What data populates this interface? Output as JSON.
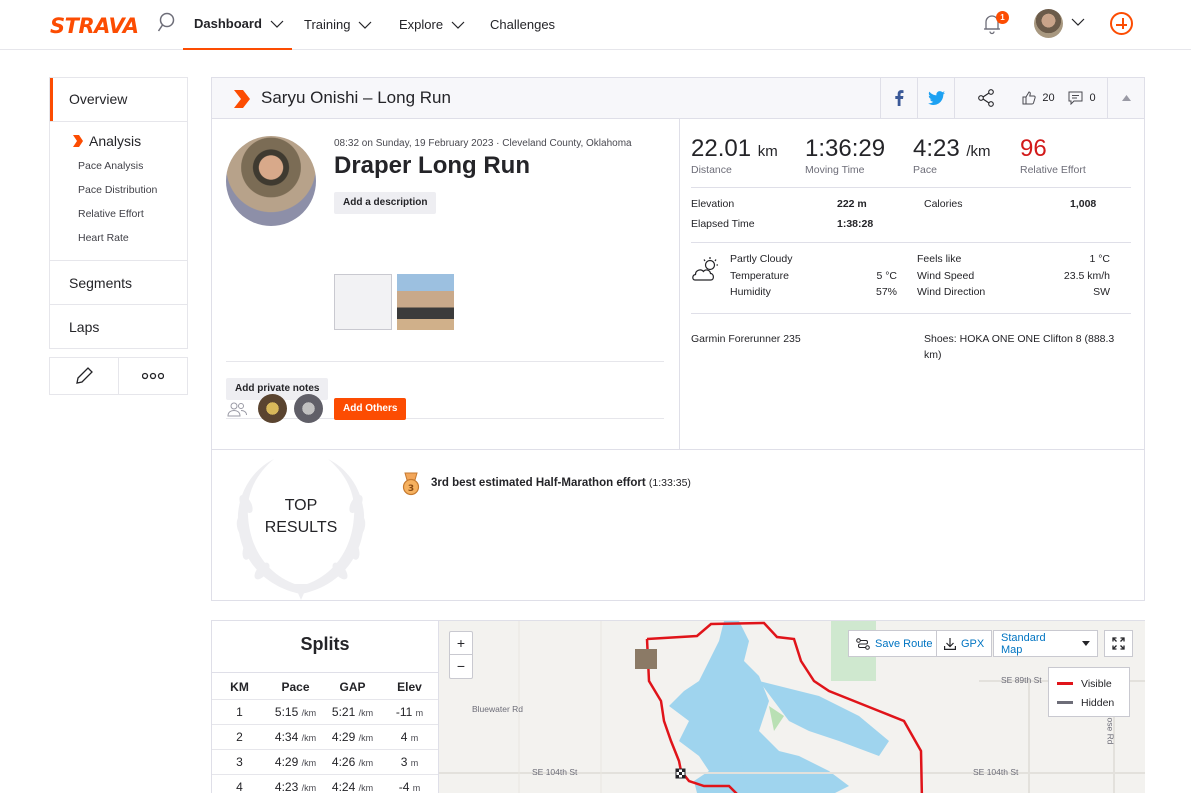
{
  "nav": {
    "logo": "STRAVA",
    "items": [
      "Dashboard",
      "Training",
      "Explore",
      "Challenges"
    ],
    "notification_count": "1"
  },
  "sidebar": {
    "overview": "Overview",
    "analysis": "Analysis",
    "sub_items": [
      "Pace Analysis",
      "Pace Distribution",
      "Relative Effort",
      "Heart Rate"
    ],
    "segments": "Segments",
    "laps": "Laps"
  },
  "activity": {
    "header_title": "Saryu Onishi – Long Run",
    "kudos": "20",
    "comments": "0",
    "meta": "08:32 on Sunday, 19 February 2023 · Cleveland County, Oklahoma",
    "name": "Draper Long Run",
    "add_description": "Add a description",
    "add_private_notes": "Add private notes",
    "add_others": "Add Others"
  },
  "stats": {
    "distance": {
      "value": "22.01",
      "unit": "km",
      "label": "Distance"
    },
    "moving_time": {
      "value": "1:36:29",
      "label": "Moving Time"
    },
    "pace": {
      "value": "4:23",
      "unit": "/km",
      "label": "Pace"
    },
    "relative_effort": {
      "value": "96",
      "label": "Relative Effort"
    },
    "elevation_label": "Elevation",
    "elevation": "222 m",
    "calories_label": "Calories",
    "calories": "1,008",
    "elapsed_label": "Elapsed Time",
    "elapsed": "1:38:28"
  },
  "weather": {
    "condition": "Partly Cloudy",
    "temperature_label": "Temperature",
    "temperature": "5 °C",
    "humidity_label": "Humidity",
    "humidity": "57%",
    "feels_label": "Feels like",
    "feels": "1 °C",
    "wind_speed_label": "Wind Speed",
    "wind_speed": "23.5 km/h",
    "wind_dir_label": "Wind Direction",
    "wind_dir": "SW"
  },
  "gear": {
    "device": "Garmin Forerunner 235",
    "shoes_line1": "Shoes: HOKA ONE ONE Clifton 8 (888.3",
    "shoes_line2": "km)"
  },
  "results": {
    "title_line1": "TOP",
    "title_line2": "RESULTS",
    "item_bold": "3rd best estimated Half-Marathon effort",
    "item_time": "(1:33:35)"
  },
  "splits": {
    "title": "Splits",
    "headers": [
      "KM",
      "Pace",
      "GAP",
      "Elev"
    ],
    "pace_unit": "/km",
    "elev_unit": "m",
    "rows": [
      {
        "km": "1",
        "pace": "5:15",
        "gap": "5:21",
        "elev": "-11"
      },
      {
        "km": "2",
        "pace": "4:34",
        "gap": "4:29",
        "elev": "4"
      },
      {
        "km": "3",
        "pace": "4:29",
        "gap": "4:26",
        "elev": "3"
      },
      {
        "km": "4",
        "pace": "4:23",
        "gap": "4:24",
        "elev": "-4"
      }
    ]
  },
  "map": {
    "zoom_in": "+",
    "zoom_out": "−",
    "save_route": "Save Route",
    "gpx": "GPX",
    "map_type": "Standard Map",
    "legend_visible": "Visible",
    "legend_hidden": "Hidden",
    "streets": [
      "Bluewater Rd",
      "SE 104th St",
      "SE 89th St",
      "SE 104th St",
      "ose Rd"
    ]
  },
  "colors": {
    "brand": "#fc4c02",
    "relative_effort": "#d21a1a",
    "route": "#e0141a"
  }
}
